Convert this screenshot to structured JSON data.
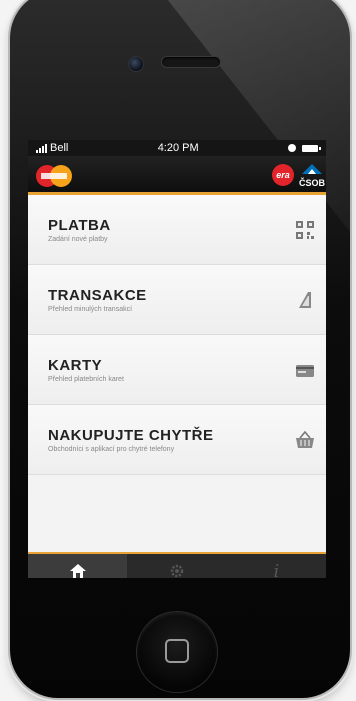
{
  "status_bar": {
    "carrier": "Bell",
    "time": "4:20 PM"
  },
  "app_bar": {
    "era_logo_text": "era",
    "csob_logo_text": "ČSOB"
  },
  "menu": [
    {
      "title": "PLATBA",
      "subtitle": "Zadání nové platby",
      "icon": "qr-code-icon"
    },
    {
      "title": "TRANSAKCE",
      "subtitle": "Přehled minulých transakcí",
      "icon": "receipt-icon"
    },
    {
      "title": "KARTY",
      "subtitle": "Přehled platebních karet",
      "icon": "card-icon"
    },
    {
      "title": "NAKUPUJTE CHYTŘE",
      "subtitle": "Obchodníci s aplikací pro chytré telefony",
      "icon": "basket-icon"
    }
  ],
  "tabs": [
    {
      "icon": "home-icon",
      "active": true
    },
    {
      "icon": "settings-icon",
      "active": false
    },
    {
      "icon": "info-icon",
      "label": "i",
      "active": false
    }
  ],
  "colors": {
    "accent": "#e8a236",
    "era_red": "#e1252a",
    "csob_blue": "#0071b9"
  }
}
